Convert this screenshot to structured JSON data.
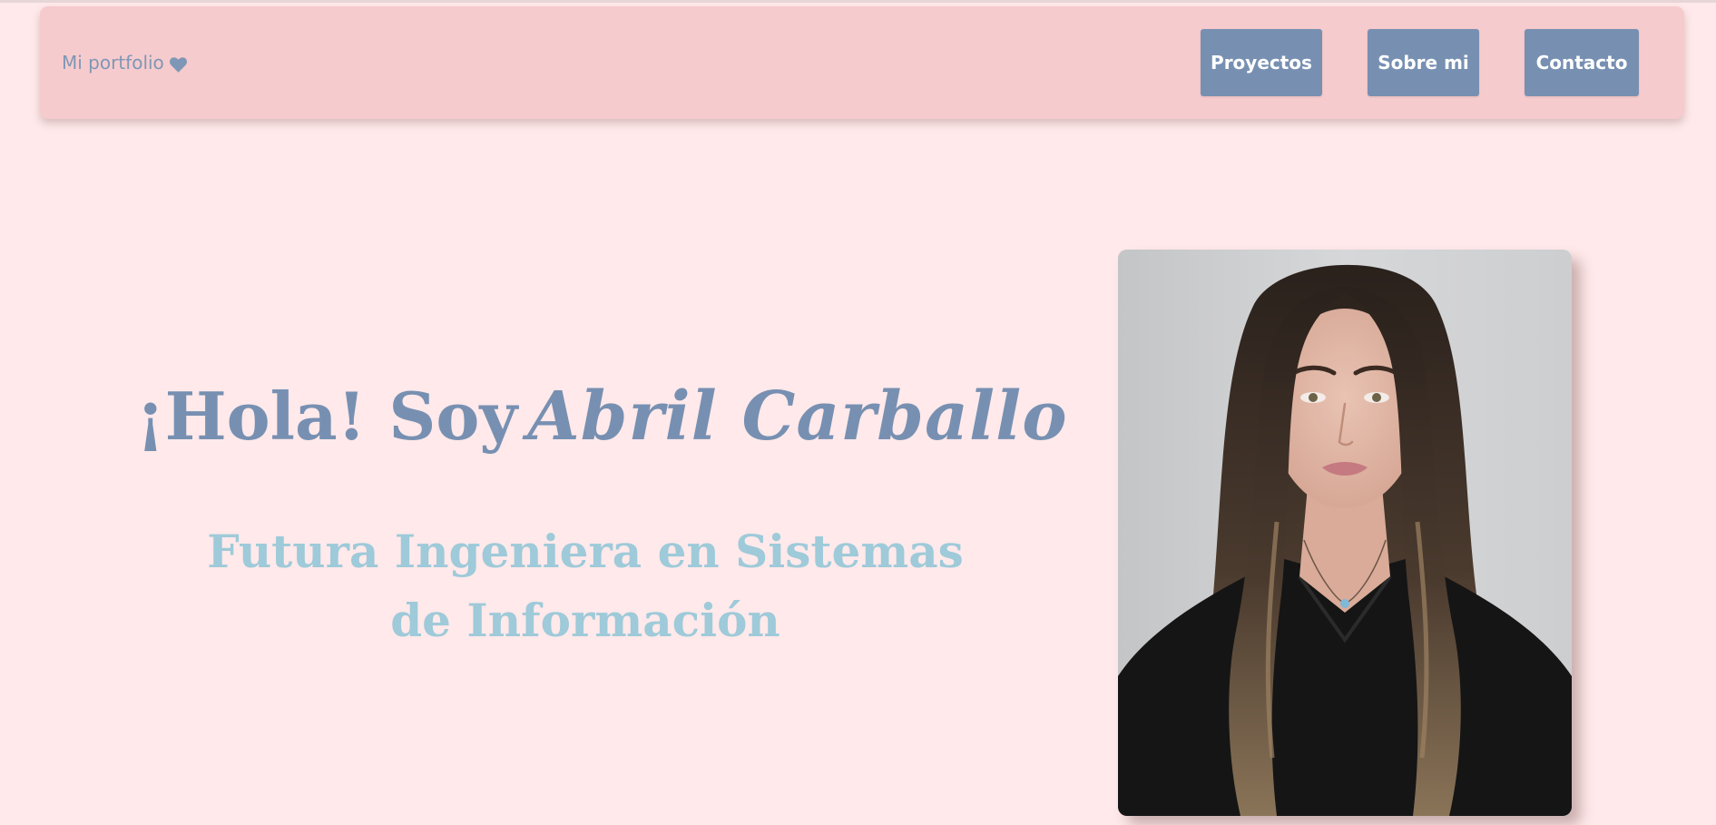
{
  "navbar": {
    "brand_label": "Mi portfolio",
    "brand_icon": "heart-icon",
    "buttons": [
      {
        "label": "Proyectos"
      },
      {
        "label": "Sobre mi"
      },
      {
        "label": "Contacto"
      }
    ]
  },
  "hero": {
    "greeting": "¡Hola! Soy",
    "name": "Abril Carballo",
    "subtitle": "Futura Ingeniera en Sistemas de Información"
  },
  "colors": {
    "page_background": "#ffe9ea",
    "navbar_background": "#f6cbcd",
    "button_background": "#7790b2",
    "title_color": "#7790b2",
    "subtitle_color": "#9ecad9"
  }
}
